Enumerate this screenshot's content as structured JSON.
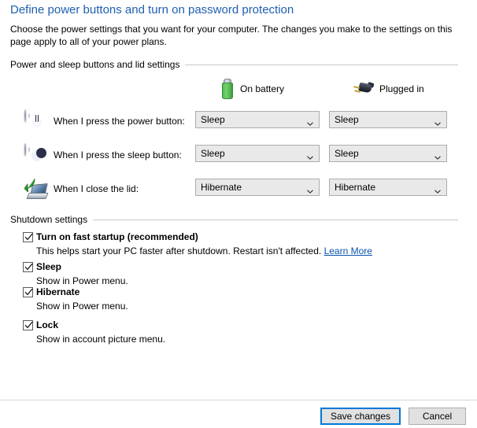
{
  "header": {
    "title": "Define power buttons and turn on password protection",
    "description": "Choose the power settings that you want for your computer. The changes you make to the settings on this page apply to all of your power plans.",
    "title_color": "#1f5fb1"
  },
  "power_group": {
    "label": "Power and sleep buttons and lid settings",
    "columns": [
      {
        "icon": "battery-icon",
        "label": "On battery"
      },
      {
        "icon": "power-plug-icon",
        "label": "Plugged in"
      }
    ],
    "rows": [
      {
        "icon": "power-button-icon",
        "label": "When I press the power button:",
        "on_battery": "Sleep",
        "plugged_in": "Sleep"
      },
      {
        "icon": "sleep-button-icon",
        "label": "When I press the sleep button:",
        "on_battery": "Sleep",
        "plugged_in": "Sleep"
      },
      {
        "icon": "laptop-lid-icon",
        "label": "When I close the lid:",
        "on_battery": "Hibernate",
        "plugged_in": "Hibernate"
      }
    ]
  },
  "shutdown_group": {
    "label": "Shutdown settings",
    "items": [
      {
        "checked": true,
        "title": "Turn on fast startup (recommended)",
        "description": "This helps start your PC faster after shutdown. Restart isn't affected.",
        "link": "Learn More"
      },
      {
        "checked": true,
        "title": "Sleep",
        "description": "Show in Power menu.",
        "link": ""
      },
      {
        "checked": true,
        "title": "Hibernate",
        "description": "Show in Power menu.",
        "link": ""
      },
      {
        "checked": true,
        "title": "Lock",
        "description": "Show in account picture menu.",
        "link": ""
      }
    ]
  },
  "footer": {
    "save_label": "Save changes",
    "cancel_label": "Cancel",
    "accent_color": "#0078d7",
    "link_color": "#0b52ad"
  }
}
